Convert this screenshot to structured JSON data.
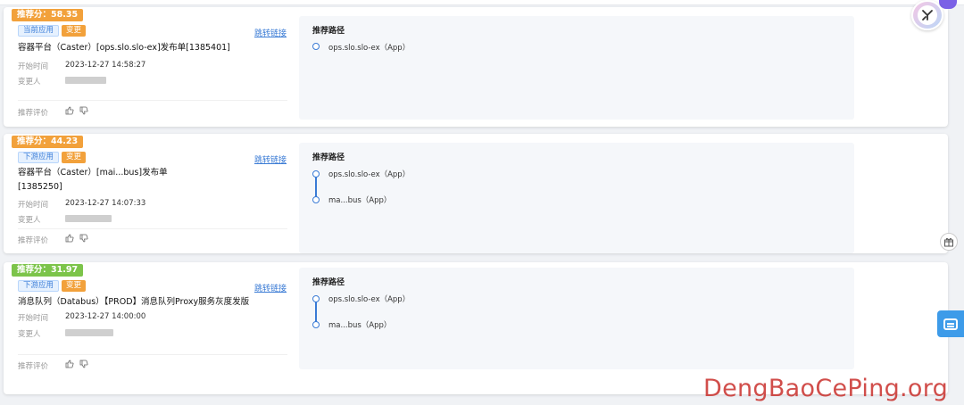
{
  "cards": [
    {
      "score": "推荐分：58.35",
      "score_color": "#f2a13b",
      "tags": [
        "当前应用",
        "变更"
      ],
      "jump_label": "跳转链接",
      "title": "容器平台（Caster）[ops.slo.slo-ex]发布单[1385401]",
      "start_label": "开始时间",
      "start_value": "2023-12-27 14:58:27",
      "changer_label": "变更人",
      "eval_label": "推荐评价",
      "path_title": "推荐路径",
      "path_nodes": [
        "ops.slo.slo-ex（App）"
      ]
    },
    {
      "score": "推荐分：44.23",
      "score_color": "#f2a13b",
      "tags": [
        "下游应用",
        "变更"
      ],
      "jump_label": "跳转链接",
      "title": "容器平台（Caster）[mai...bus]发布单",
      "title_line2": "[1385250]",
      "start_label": "开始时间",
      "start_value": "2023-12-27 14:07:33",
      "changer_label": "变更人",
      "eval_label": "推荐评价",
      "path_title": "推荐路径",
      "path_nodes": [
        "ops.slo.slo-ex（App）",
        "ma...bus（App）"
      ]
    },
    {
      "score": "推荐分：31.97",
      "score_color": "#7cc44a",
      "tags": [
        "下游应用",
        "变更"
      ],
      "jump_label": "跳转链接",
      "title": "消息队列（Databus）【PROD】消息队列Proxy服务灰度发版",
      "start_label": "开始时间",
      "start_value": "2023-12-27 14:00:00",
      "changer_label": "变更人",
      "eval_label": "推荐评价",
      "path_title": "推荐路径",
      "path_nodes": [
        "ops.slo.slo-ex（App）",
        "ma...bus（App）"
      ]
    }
  ],
  "icons": {
    "thumb_up": "thumb-up-icon",
    "thumb_down": "thumb-down-icon",
    "gift": "gift-icon",
    "feedback": "chat-icon",
    "logo": "app-logo-icon"
  },
  "footer_watermark": "DengBaoCePing.org"
}
